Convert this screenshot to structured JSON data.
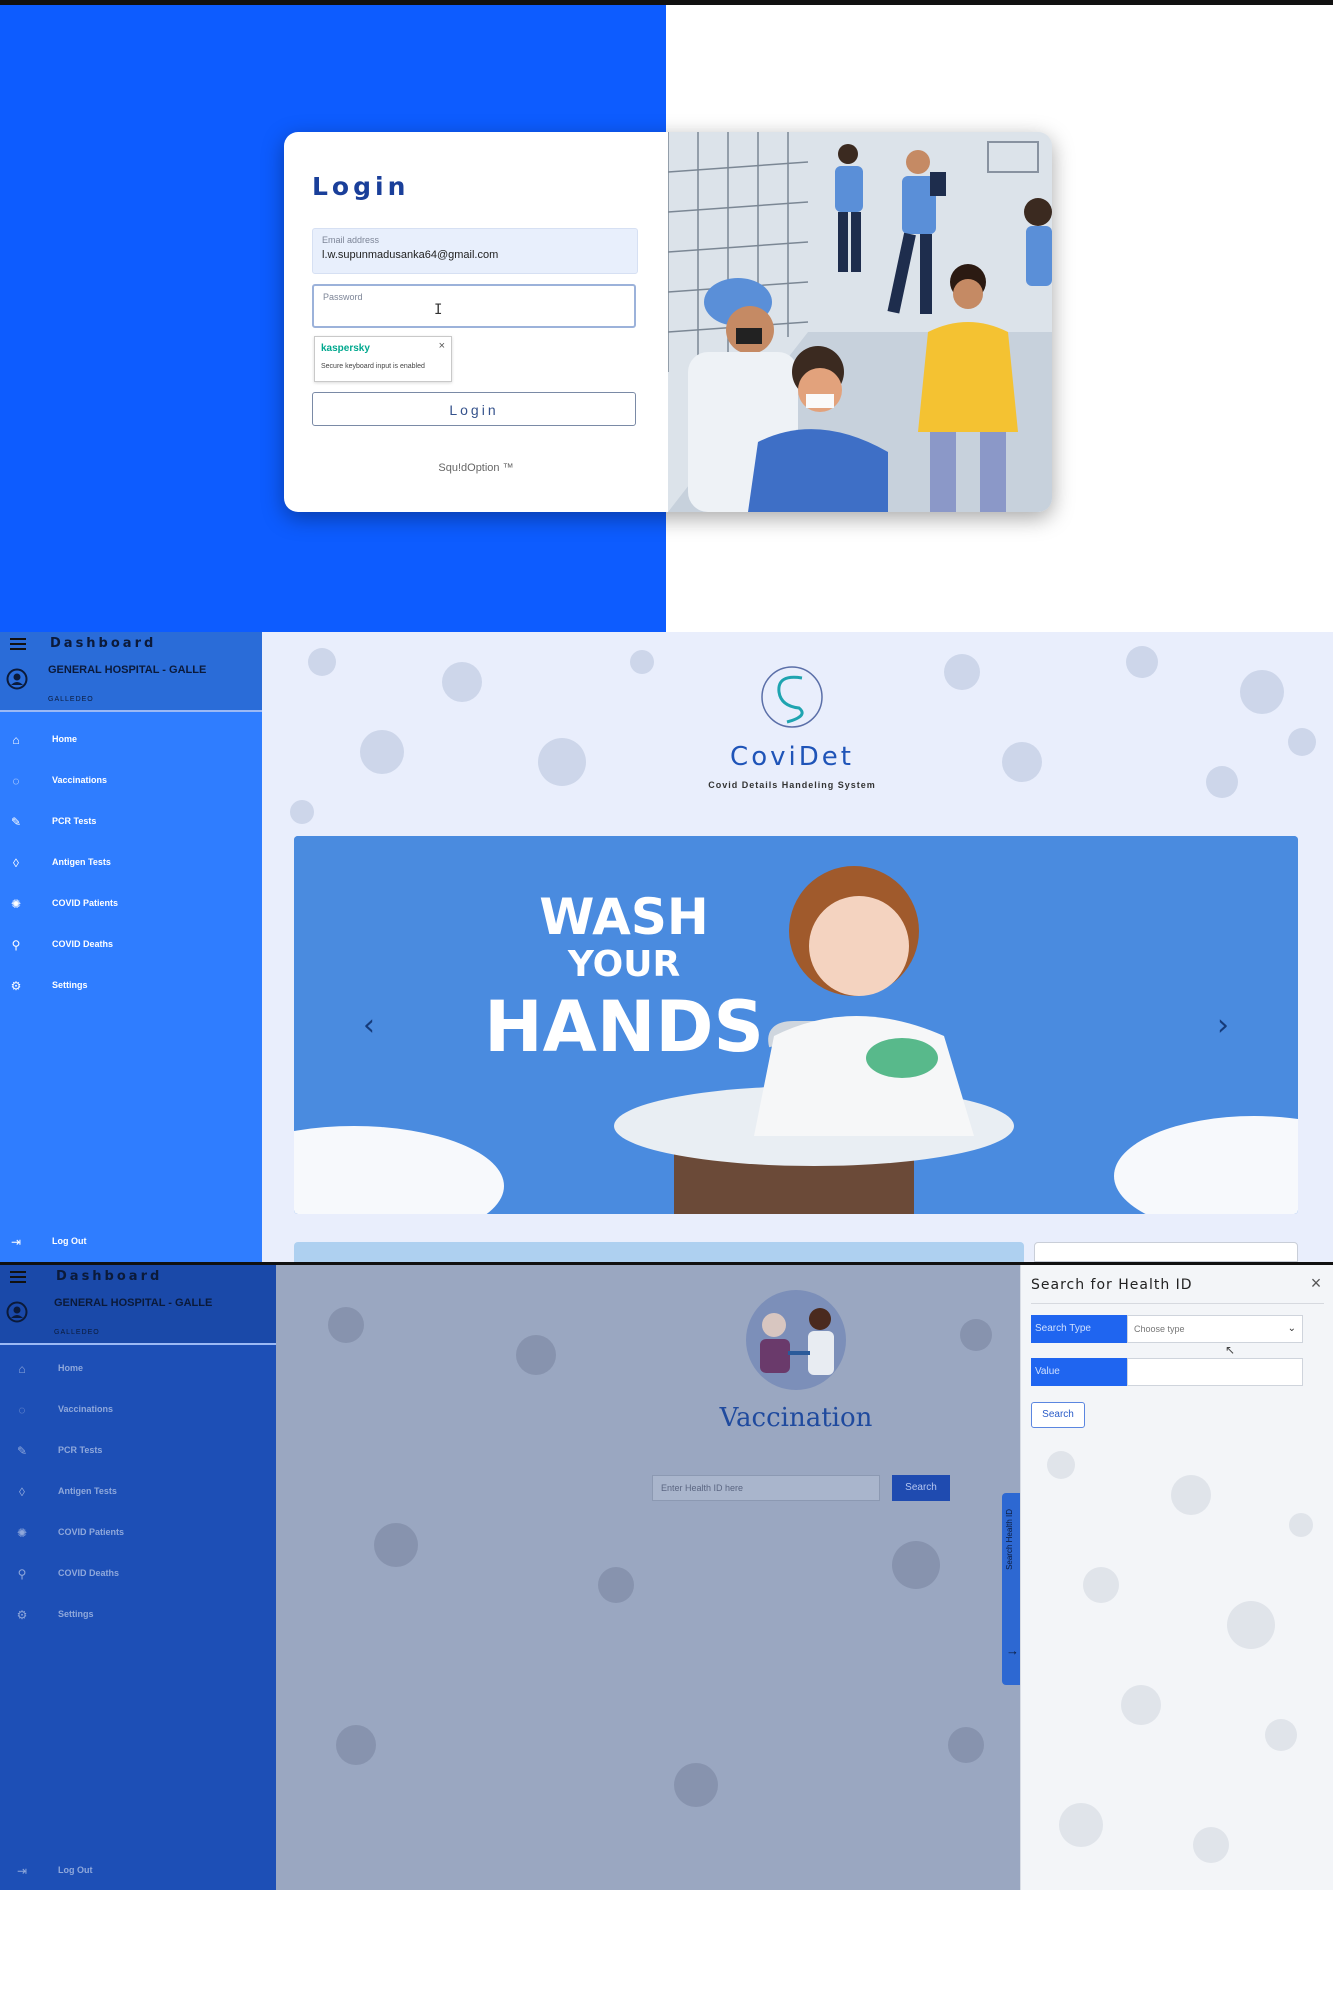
{
  "login": {
    "title": "Login",
    "email_label": "Email address",
    "email_value": "l.w.supunmadusanka64@gmail.com",
    "password_label": "Password",
    "kaspersky_brand": "kaspersky",
    "kaspersky_message": "Secure keyboard input is enabled",
    "login_button": "Login",
    "footer": "Squ!dOption ™",
    "colors": {
      "left_bg": "#0d5cff",
      "title": "#1a3f9a"
    }
  },
  "dashboard": {
    "title": "Dashboard",
    "hospital": "GENERAL HOSPITAL - GALLE",
    "hospital_sub": "GALLEDEO",
    "nav": [
      {
        "label": "Home",
        "icon": "home-icon"
      },
      {
        "label": "Vaccinations",
        "icon": "syringe-circle-icon"
      },
      {
        "label": "PCR Tests",
        "icon": "test-tube-icon"
      },
      {
        "label": "Antigen Tests",
        "icon": "antigen-icon"
      },
      {
        "label": "COVID Patients",
        "icon": "virus-icon"
      },
      {
        "label": "COVID Deaths",
        "icon": "search-virus-icon"
      },
      {
        "label": "Settings",
        "icon": "gear-icon"
      }
    ],
    "logout": "Log Out",
    "brand_title": "CoviDet",
    "brand_subtitle": "Covid Details Handeling System",
    "hero": {
      "line1": "WASH",
      "line2": "YOUR",
      "line3": "HANDS"
    },
    "colors": {
      "sidebar": "#2f7dff",
      "brand": "#1f54b8"
    }
  },
  "vaccination": {
    "title": "Vaccination",
    "input_placeholder": "Enter Health ID here",
    "search_button": "Search",
    "side_tab": "Search Health ID",
    "drawer": {
      "title": "Search for Health ID",
      "search_type_label": "Search Type",
      "type_placeholder": "Choose type",
      "value_label": "Value",
      "search_button": "Search"
    }
  }
}
